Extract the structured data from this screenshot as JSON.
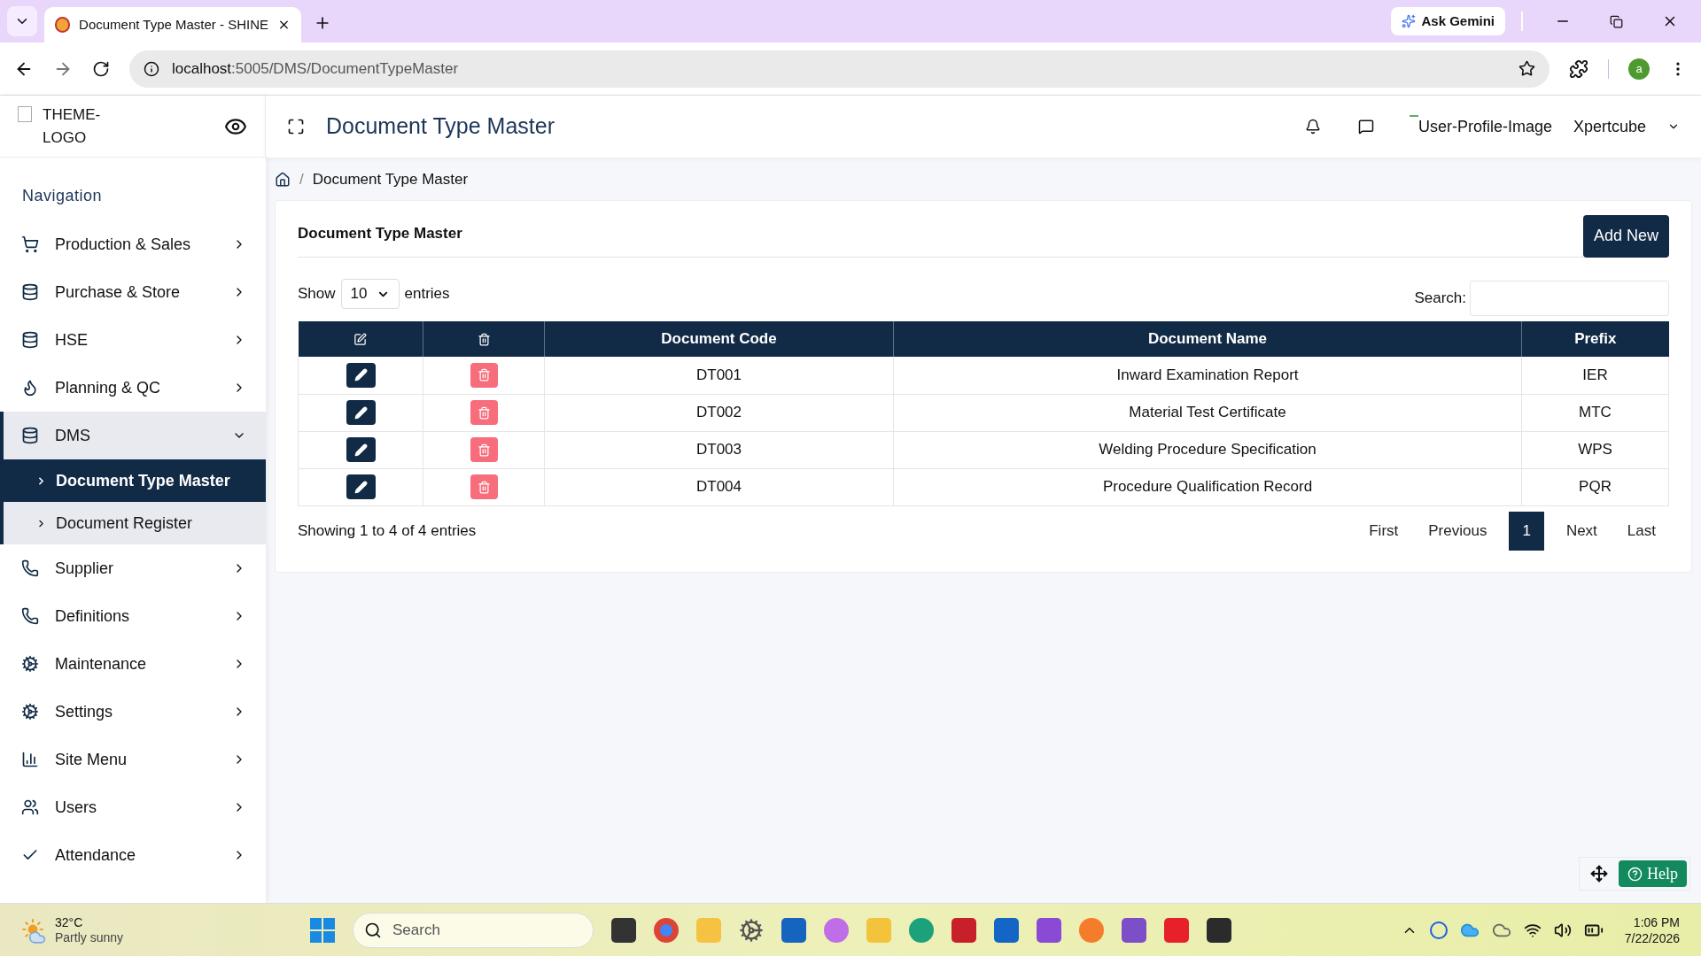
{
  "browser": {
    "tab_title": "Document Type Master - SHINE",
    "ask_gemini": "Ask Gemini",
    "url_host": "localhost",
    "url_path": ":5005/DMS/DocumentTypeMaster",
    "profile_initial": "a"
  },
  "header": {
    "logo_alt": "THEME-LOGO",
    "page_title": "Document Type Master",
    "profile_image_alt": "User-Profile-Image",
    "user_name": "Xpertcube"
  },
  "sidebar": {
    "heading": "Navigation",
    "items": [
      {
        "label": "Production & Sales",
        "expanded": false
      },
      {
        "label": "Purchase & Store",
        "expanded": false
      },
      {
        "label": "HSE",
        "expanded": false
      },
      {
        "label": "Planning & QC",
        "expanded": false
      },
      {
        "label": "DMS",
        "expanded": true,
        "children": [
          {
            "label": "Document Type Master",
            "selected": true
          },
          {
            "label": "Document Register",
            "selected": false
          }
        ]
      },
      {
        "label": "Supplier",
        "expanded": false
      },
      {
        "label": "Definitions",
        "expanded": false
      },
      {
        "label": "Maintenance",
        "expanded": false
      },
      {
        "label": "Settings",
        "expanded": false
      },
      {
        "label": "Site Menu",
        "expanded": false
      },
      {
        "label": "Users",
        "expanded": false
      },
      {
        "label": "Attendance",
        "expanded": false
      }
    ]
  },
  "breadcrumb": {
    "separator": "/",
    "current": "Document Type Master"
  },
  "card": {
    "title": "Document Type Master",
    "add_button": "Add New",
    "show_label": "Show",
    "page_size": "10",
    "entries_label": "entries",
    "search_label": "Search:",
    "columns": [
      "Document Code",
      "Document Name",
      "Prefix"
    ],
    "rows": [
      {
        "code": "DT001",
        "name": "Inward Examination Report",
        "prefix": "IER"
      },
      {
        "code": "DT002",
        "name": "Material Test Certificate",
        "prefix": "MTC"
      },
      {
        "code": "DT003",
        "name": "Welding Procedure Specification",
        "prefix": "WPS"
      },
      {
        "code": "DT004",
        "name": "Procedure Qualification Record",
        "prefix": "PQR"
      }
    ],
    "info": "Showing 1 to 4 of 4 entries",
    "pagination": [
      {
        "label": "First",
        "selected": false
      },
      {
        "label": "Previous",
        "selected": false
      },
      {
        "label": "1",
        "selected": true
      },
      {
        "label": "Next",
        "selected": false
      },
      {
        "label": "Last",
        "selected": false
      }
    ]
  },
  "help_button": "Help",
  "taskbar": {
    "temperature": "32°C",
    "condition": "Partly sunny",
    "search_placeholder": "Search",
    "time": "1:06 PM",
    "date": "7/22/2026"
  }
}
